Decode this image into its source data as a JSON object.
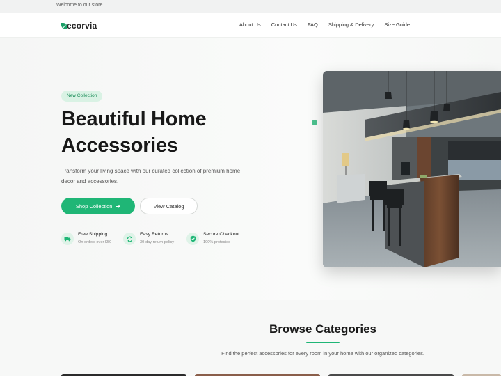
{
  "topbar": {
    "welcome": "Welcome to our store"
  },
  "brand": {
    "name": "ecorvia",
    "accent": "#1fb676"
  },
  "nav": {
    "links": [
      "About Us",
      "Contact Us",
      "FAQ",
      "Shipping & Delivery",
      "Size Guide"
    ]
  },
  "hero": {
    "badge": "New Collection",
    "title": "Beautiful Home Accessories",
    "description": "Transform your living space with our curated collection of premium home decor and accessories.",
    "primary_button": "Shop Collection",
    "secondary_button": "View Catalog",
    "image_icon": "kitchen-photo",
    "features": [
      {
        "title": "Free Shipping",
        "subtitle": "On orders over $50",
        "icon": "truck-icon"
      },
      {
        "title": "Easy Returns",
        "subtitle": "30-day return policy",
        "icon": "return-icon"
      },
      {
        "title": "Secure Checkout",
        "subtitle": "100% protected",
        "icon": "shield-icon"
      }
    ]
  },
  "browse": {
    "title": "Browse Categories",
    "subtitle": "Find the perfect accessories for every room in your home with our organized categories."
  }
}
